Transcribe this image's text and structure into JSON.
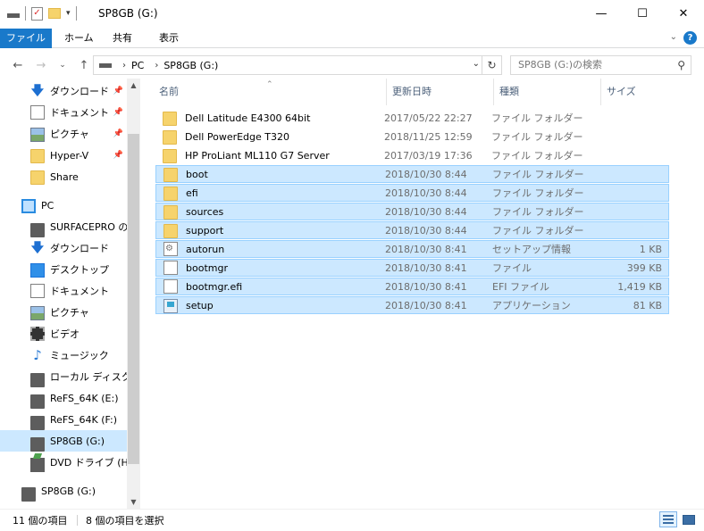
{
  "window": {
    "title": "SP8GB (G:)",
    "minimize": "—",
    "maximize": "☐",
    "close": "✕"
  },
  "ribbon": {
    "tabs": [
      "ファイル",
      "ホーム",
      "共有",
      "表示"
    ],
    "help": "?"
  },
  "address": {
    "crumbs": [
      "PC",
      "SP8GB (G:)"
    ],
    "search_placeholder": "SP8GB (G:)の検索"
  },
  "nav": {
    "items": [
      {
        "label": "ダウンロード",
        "icon": "download-icon",
        "pinned": true
      },
      {
        "label": "ドキュメント",
        "icon": "documents-icon",
        "pinned": true
      },
      {
        "label": "ピクチャ",
        "icon": "pictures-icon",
        "pinned": true
      },
      {
        "label": "Hyper-V",
        "icon": "folder-icon",
        "pinned": true
      },
      {
        "label": "Share",
        "icon": "folder-icon",
        "pinned": false
      },
      {
        "label": "PC",
        "icon": "pc-icon",
        "pinned": false
      },
      {
        "label": "SURFACEPRO の",
        "icon": "drive-icon",
        "pinned": false
      },
      {
        "label": "ダウンロード",
        "icon": "download-icon",
        "pinned": false
      },
      {
        "label": "デスクトップ",
        "icon": "desktop-icon",
        "pinned": false
      },
      {
        "label": "ドキュメント",
        "icon": "documents-icon",
        "pinned": false
      },
      {
        "label": "ピクチャ",
        "icon": "pictures-icon",
        "pinned": false
      },
      {
        "label": "ビデオ",
        "icon": "videos-icon",
        "pinned": false
      },
      {
        "label": "ミュージック",
        "icon": "music-icon",
        "pinned": false
      },
      {
        "label": "ローカル ディスク (C",
        "icon": "drive-icon",
        "pinned": false
      },
      {
        "label": "ReFS_64K (E:)",
        "icon": "drive-icon",
        "pinned": false
      },
      {
        "label": "ReFS_64K (F:)",
        "icon": "drive-icon",
        "pinned": false
      },
      {
        "label": "SP8GB (G:)",
        "icon": "drive-icon",
        "pinned": false,
        "selected": true
      },
      {
        "label": "DVD ドライブ (H:)",
        "icon": "dvd-icon",
        "pinned": false
      },
      {
        "label": "SP8GB (G:)",
        "icon": "drive-icon",
        "pinned": false
      }
    ]
  },
  "list": {
    "columns": [
      "名前",
      "更新日時",
      "種類",
      "サイズ"
    ],
    "rows": [
      {
        "name": "Dell Latitude E4300 64bit",
        "date": "2017/05/22 22:27",
        "type": "ファイル フォルダー",
        "size": "",
        "icon": "folder-icon",
        "selected": false
      },
      {
        "name": "Dell PowerEdge T320",
        "date": "2018/11/25 12:59",
        "type": "ファイル フォルダー",
        "size": "",
        "icon": "folder-icon",
        "selected": false
      },
      {
        "name": "HP ProLiant ML110 G7 Server",
        "date": "2017/03/19 17:36",
        "type": "ファイル フォルダー",
        "size": "",
        "icon": "folder-icon",
        "selected": false
      },
      {
        "name": "boot",
        "date": "2018/10/30 8:44",
        "type": "ファイル フォルダー",
        "size": "",
        "icon": "folder-icon",
        "selected": true
      },
      {
        "name": "efi",
        "date": "2018/10/30 8:44",
        "type": "ファイル フォルダー",
        "size": "",
        "icon": "folder-icon",
        "selected": true
      },
      {
        "name": "sources",
        "date": "2018/10/30 8:44",
        "type": "ファイル フォルダー",
        "size": "",
        "icon": "folder-icon",
        "selected": true
      },
      {
        "name": "support",
        "date": "2018/10/30 8:44",
        "type": "ファイル フォルダー",
        "size": "",
        "icon": "folder-icon",
        "selected": true
      },
      {
        "name": "autorun",
        "date": "2018/10/30 8:41",
        "type": "セットアップ情報",
        "size": "1 KB",
        "icon": "settings-file-icon",
        "selected": true
      },
      {
        "name": "bootmgr",
        "date": "2018/10/30 8:41",
        "type": "ファイル",
        "size": "399 KB",
        "icon": "file-icon",
        "selected": true
      },
      {
        "name": "bootmgr.efi",
        "date": "2018/10/30 8:41",
        "type": "EFI ファイル",
        "size": "1,419 KB",
        "icon": "file-icon",
        "selected": true
      },
      {
        "name": "setup",
        "date": "2018/10/30 8:41",
        "type": "アプリケーション",
        "size": "81 KB",
        "icon": "setup-icon",
        "selected": true
      }
    ]
  },
  "status": {
    "item_count": "11 個の項目",
    "selected_count": "8 個の項目を選択"
  },
  "colors": {
    "accent": "#1979ca",
    "selection": "#cce8ff",
    "selection_border": "#99d1ff"
  }
}
